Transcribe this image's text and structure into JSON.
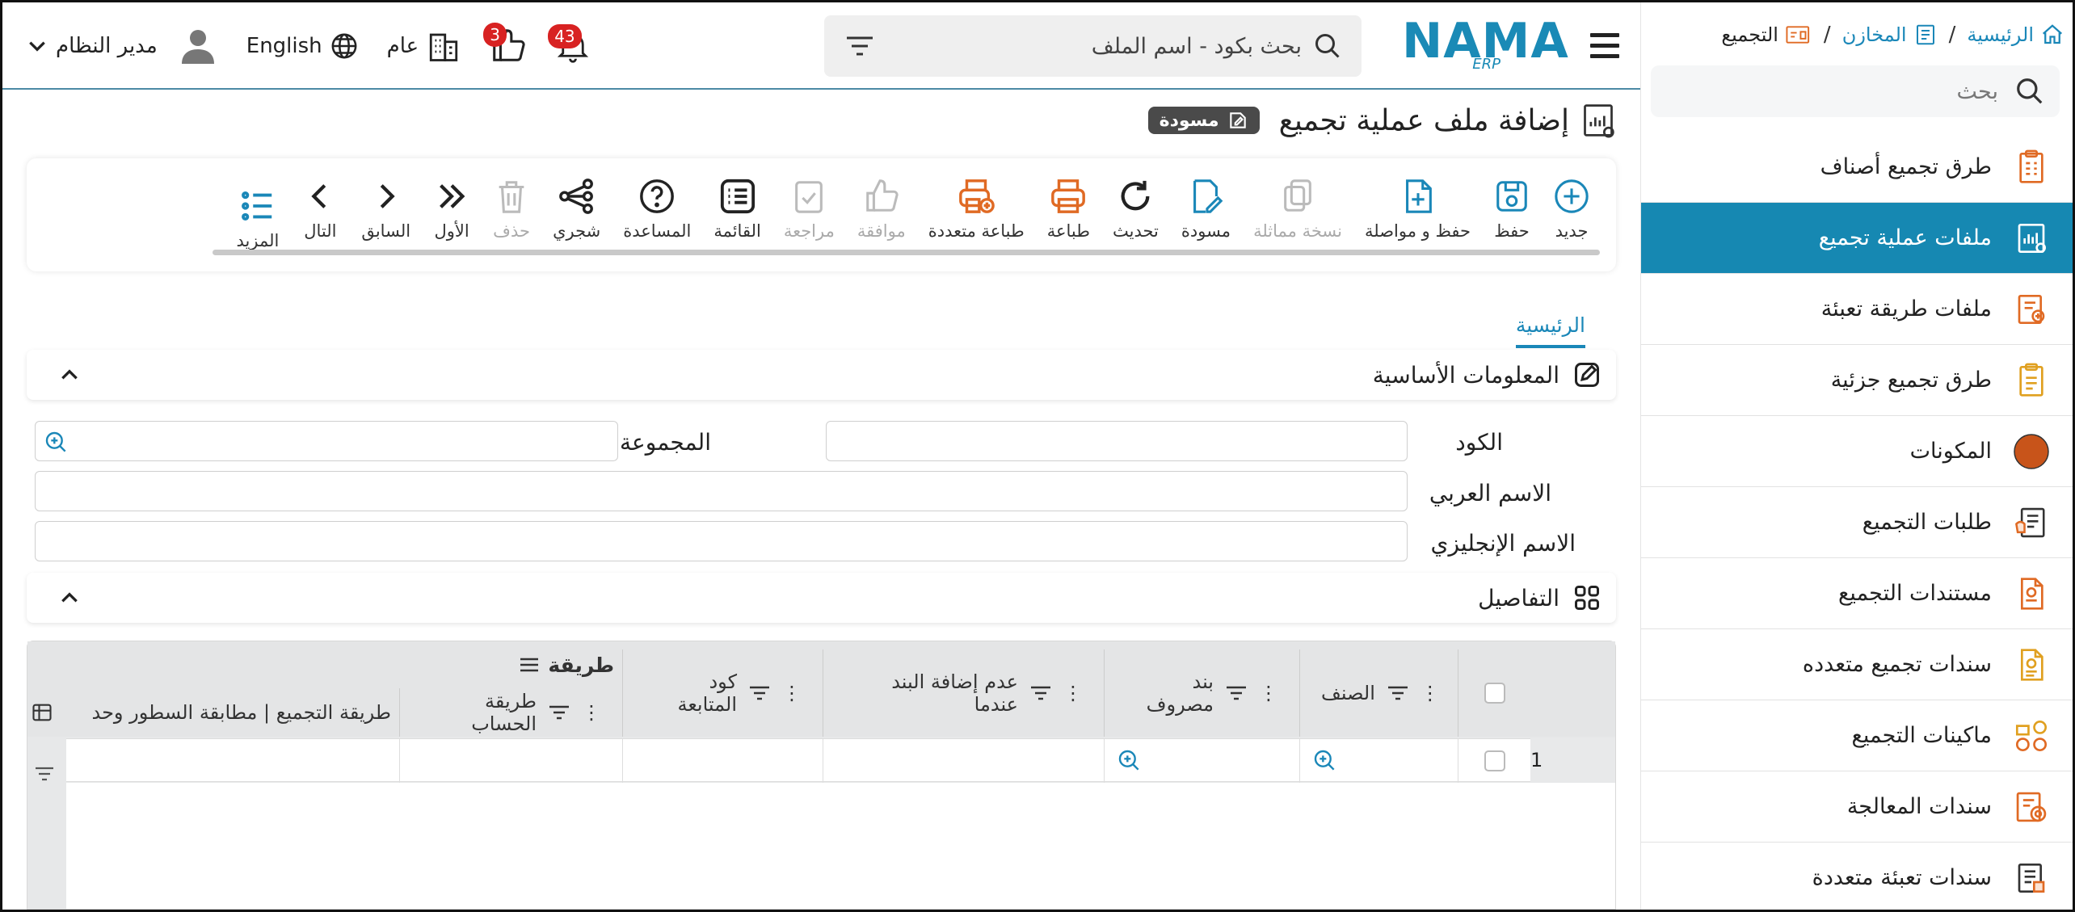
{
  "breadcrumb": {
    "home": "الرئيسية",
    "warehouses": "المخازن",
    "current": "التجميع"
  },
  "sidebar": {
    "search_placeholder": "بحث",
    "items": [
      {
        "label": "طرق تجميع أصناف",
        "icon": "assembly-methods-icon"
      },
      {
        "label": "ملفات عملية تجميع",
        "icon": "assembly-files-icon"
      },
      {
        "label": "ملفات طريقة تعبئة",
        "icon": "packing-files-icon"
      },
      {
        "label": "طرق تجميع جزئية",
        "icon": "partial-assembly-icon"
      },
      {
        "label": "المكونات",
        "icon": "components-icon"
      },
      {
        "label": "طلبات التجميع",
        "icon": "assembly-requests-icon"
      },
      {
        "label": "مستندات التجميع",
        "icon": "assembly-documents-icon"
      },
      {
        "label": "سندات تجميع متعدده",
        "icon": "multi-assembly-vouchers-icon"
      },
      {
        "label": "ماكينات التجميع",
        "icon": "assembly-machines-icon"
      },
      {
        "label": "سندات المعالجة",
        "icon": "processing-vouchers-icon"
      },
      {
        "label": "سندات تعبئة متعددة",
        "icon": "multi-packing-vouchers-icon"
      }
    ]
  },
  "topbar": {
    "logo_text": "NAMA",
    "logo_sub": "ERP",
    "search_placeholder": "بحث بكود - اسم الملف",
    "notifications_count": "43",
    "approvals_count": "3",
    "branch": "عام",
    "language": "English",
    "user": "مدير النظام"
  },
  "page": {
    "title": "إضافة ملف عملية تجميع",
    "status_badge": "مسودة"
  },
  "toolbar": [
    {
      "label": "جديد",
      "icon": "plus-circle-icon",
      "disabled": false
    },
    {
      "label": "حفظ",
      "icon": "save-icon",
      "disabled": false
    },
    {
      "label": "حفظ و مواصلة",
      "icon": "save-continue-icon",
      "disabled": false
    },
    {
      "label": "نسخة مماثلة",
      "icon": "copy-icon",
      "disabled": true
    },
    {
      "label": "مسودة",
      "icon": "draft-edit-icon",
      "disabled": false
    },
    {
      "label": "تحديث",
      "icon": "refresh-icon",
      "disabled": false
    },
    {
      "label": "طباعة",
      "icon": "print-icon",
      "disabled": false
    },
    {
      "label": "طباعة متعددة",
      "icon": "multi-print-icon",
      "disabled": false
    },
    {
      "label": "موافقة",
      "icon": "thumbs-up-icon",
      "disabled": true
    },
    {
      "label": "مراجعة",
      "icon": "review-icon",
      "disabled": true
    },
    {
      "label": "القائمة",
      "icon": "list-icon",
      "disabled": false
    },
    {
      "label": "المساعدة",
      "icon": "help-icon",
      "disabled": false
    },
    {
      "label": "شجري",
      "icon": "tree-icon",
      "disabled": false
    },
    {
      "label": "حذف",
      "icon": "trash-icon",
      "disabled": true
    },
    {
      "label": "الأول",
      "icon": "first-icon",
      "disabled": false
    },
    {
      "label": "السابق",
      "icon": "previous-icon",
      "disabled": false
    },
    {
      "label": "التال",
      "icon": "next-icon",
      "disabled": false
    },
    {
      "label": "المزيد",
      "icon": "more-icon",
      "disabled": false
    }
  ],
  "tabs": {
    "main": "الرئيسية"
  },
  "sections": {
    "basic_info": "المعلومات الأساسية",
    "details": "التفاصيل"
  },
  "form": {
    "code_label": "الكود",
    "group_label": "المجموعة",
    "arabic_name_label": "الاسم العربي",
    "english_name_label": "الاسم الإنجليزي"
  },
  "grid": {
    "group_title": "طريقة",
    "columns_top": [
      "الصنف",
      "بند مصروف",
      "عدم إضافة البند عندما",
      "كود المتابعة"
    ],
    "columns_bottom": [
      "طريقة الحساب",
      "طريقة التجميع | مطابقة السطور وحد"
    ],
    "rows": [
      {
        "num": "1"
      }
    ]
  },
  "colors": {
    "accent": "#1688b2",
    "orange": "#e06a24",
    "badge_red": "#d82222"
  }
}
